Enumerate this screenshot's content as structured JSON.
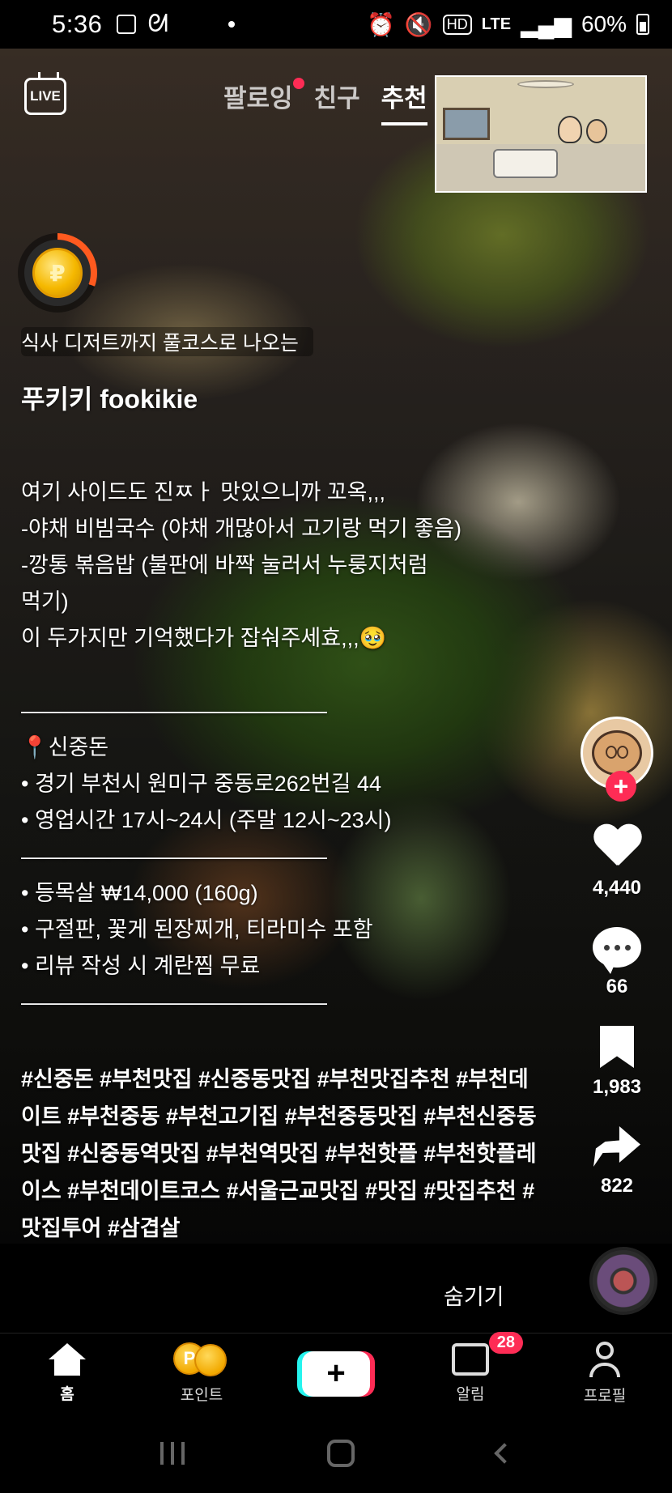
{
  "status_bar": {
    "time": "5:36",
    "network": "LTE",
    "battery": "60%"
  },
  "top_tabs": {
    "live_label": "LIVE",
    "tabs": [
      "팔로잉",
      "친구",
      "추천"
    ],
    "active_tab": "추천"
  },
  "video": {
    "song_strip": "식사 디저트까지 풀코스로 나오는",
    "username": "푸키키 fookikie",
    "description": "여기 사이드도 진ㅉㅏ 맛있으니까 꼬옥,,,\n-야채 비빔국수 (야채 개많아서 고기랑 먹기 좋음)\n-깡통 볶음밥 (불판에 바짝 눌러서 누룽지처럼\n먹기)\n이 두가지만 기억했다가 잡숴주세효,,,🥹\n\n——————————————\n📍신중돈\n• 경기 부천시 원미구 중동로262번길 44\n• 영업시간 17시~24시 (주말 12시~23시)\n——————————————\n• 등목살 ₩14,000 (160g)\n• 구절판, 꽃게 된장찌개, 티라미수 포함\n• 리뷰 작성 시 계란찜 무료\n——————————————",
    "hashtags": "#신중돈 #부천맛집 #신중동맛집 #부천맛집추천\n#부천데이트 #부천중동 #부천고기집\n#부천중동맛집 #부천신중동맛집 #신중동역맛집\n#부천역맛집 #부천핫플 #부천핫플레이스\n#부천데이트코스 #서울근교맛집 #맛집\n#맛집추천 #맛집투어 #삼겹살",
    "hide_label": "숨기기"
  },
  "rail": {
    "follow_plus": "+",
    "likes": "4,440",
    "comments": "66",
    "bookmarks": "1,983",
    "shares": "822"
  },
  "bottom_nav": {
    "home": "홈",
    "points": "포인트",
    "create": "+",
    "inbox": "알림",
    "inbox_badge": "28",
    "profile": "프로필"
  },
  "colors": {
    "accent": "#fe2c55",
    "cyan": "#25f4ee",
    "coin": "#f5b800"
  }
}
